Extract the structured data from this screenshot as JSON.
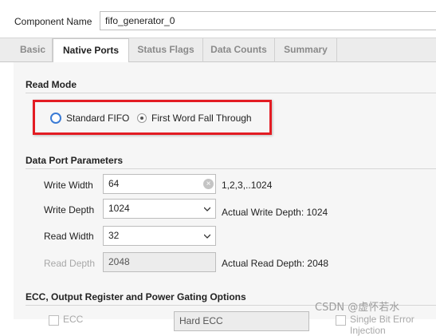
{
  "header": {
    "component_label": "Component Name",
    "component_value": "fifo_generator_0"
  },
  "tabs": [
    {
      "label": "Basic"
    },
    {
      "label": "Native Ports"
    },
    {
      "label": "Status Flags"
    },
    {
      "label": "Data Counts"
    },
    {
      "label": "Summary"
    }
  ],
  "read_mode": {
    "title": "Read Mode",
    "options": [
      {
        "label": "Standard FIFO",
        "selected": false
      },
      {
        "label": "First Word Fall Through",
        "selected": true
      }
    ]
  },
  "data_port": {
    "title": "Data Port Parameters",
    "write_width": {
      "label": "Write Width",
      "value": "64",
      "hint": "1,2,3,..1024"
    },
    "write_depth": {
      "label": "Write Depth",
      "value": "1024",
      "hint": "Actual Write Depth: 1024"
    },
    "read_width": {
      "label": "Read Width",
      "value": "32"
    },
    "read_depth": {
      "label": "Read Depth",
      "value": "2048",
      "hint": "Actual Read Depth: 2048"
    }
  },
  "ecc": {
    "title": "ECC, Output Register and Power Gating Options",
    "ecc_label": "ECC",
    "select_value": "Hard ECC",
    "right_label": "Single Bit Error Injection"
  },
  "watermark": "CSDN @虚怀若水",
  "colors": {
    "highlight": "#e31c23",
    "radio_focus": "#3a7bd5"
  }
}
